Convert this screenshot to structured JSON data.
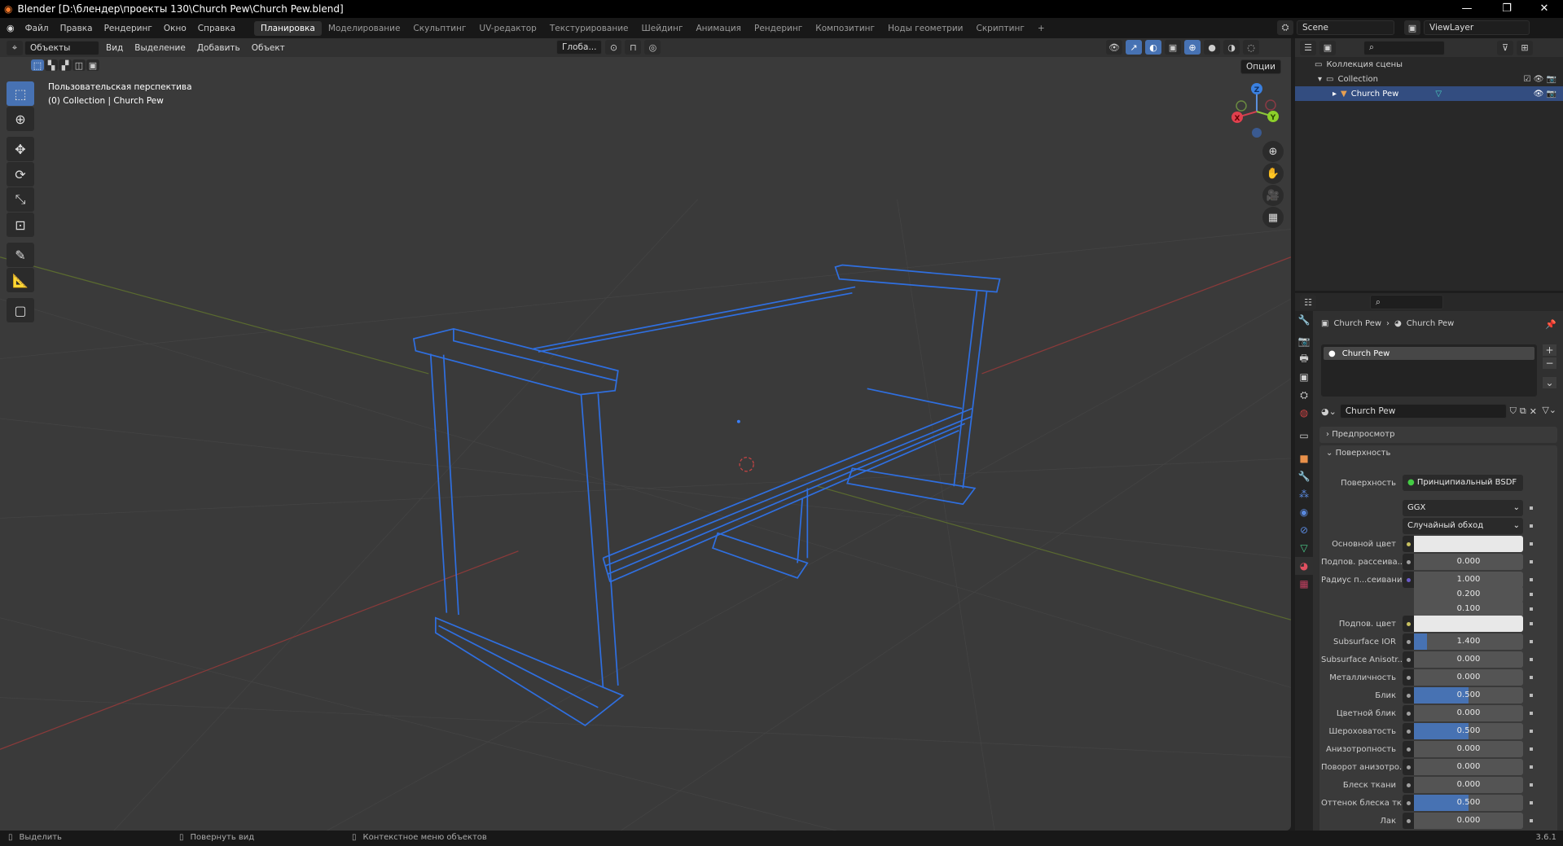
{
  "window": {
    "title": "Blender [D:\\блендер\\проекты 130\\Church Pew\\Church Pew.blend]",
    "minimize": "—",
    "maximize": "❐",
    "close": "✕"
  },
  "menu": {
    "items": [
      "Файл",
      "Правка",
      "Рендеринг",
      "Окно",
      "Справка"
    ]
  },
  "workspaces": {
    "tabs": [
      "Планировка",
      "Моделирование",
      "Скульптинг",
      "UV-редактор",
      "Текстурирование",
      "Шейдинг",
      "Анимация",
      "Рендеринг",
      "Композитинг",
      "Ноды геометрии",
      "Скриптинг",
      "+"
    ],
    "active": "Планировка"
  },
  "scene": {
    "scene_name": "Scene",
    "view_layer": "ViewLayer"
  },
  "viewport": {
    "mode": "Объекты",
    "menus": [
      "Вид",
      "Выделение",
      "Добавить",
      "Объект"
    ],
    "orientation": "Глоба...",
    "options": "Опции",
    "view_name": "Пользовательская перспектива",
    "view_info": "(0) Collection | Church Pew",
    "gizmo": {
      "z": "Z",
      "x": "X",
      "y": "Y"
    },
    "wire_color": "#2f6fe0"
  },
  "outliner": {
    "scene_collection": "Коллекция сцены",
    "collection": "Collection",
    "object": "Church Pew"
  },
  "properties": {
    "breadcrumb": [
      "Church Pew",
      "Church Pew"
    ],
    "slot": "Church Pew",
    "material_name": "Church Pew",
    "panels": {
      "preview": "Предпросмотр",
      "surface": "Поверхность"
    },
    "surface_label": "Поверхность",
    "surface_value": "Принципиальный BSDF",
    "distribution": "GGX",
    "subsurface_method": "Случайный обход",
    "rows": [
      {
        "label": "Основной цвет",
        "type": "color",
        "value": "#e8e8e8",
        "socket": "#c8c060"
      },
      {
        "label": "Подпов. рассеива...",
        "type": "num",
        "value": "0.000",
        "fill": 0
      },
      {
        "label": "Радиус п...сеивания",
        "type": "num",
        "value": "1.000",
        "fill": 0,
        "socket": "#6a5ac8"
      },
      {
        "label": "",
        "type": "num",
        "value": "0.200",
        "fill": 0,
        "nosock": true
      },
      {
        "label": "",
        "type": "num",
        "value": "0.100",
        "fill": 0,
        "nosock": true
      },
      {
        "label": "Подпов. цвет",
        "type": "color",
        "value": "#e8e8e8",
        "socket": "#c8c060"
      },
      {
        "label": "Subsurface IOR",
        "type": "num",
        "value": "1.400",
        "fill": 0.12
      },
      {
        "label": "Subsurface Anisotr...",
        "type": "num",
        "value": "0.000",
        "fill": 0
      },
      {
        "label": "Металличность",
        "type": "num",
        "value": "0.000",
        "fill": 0
      },
      {
        "label": "Блик",
        "type": "num",
        "value": "0.500",
        "fill": 0.5
      },
      {
        "label": "Цветной блик",
        "type": "num",
        "value": "0.000",
        "fill": 0
      },
      {
        "label": "Шероховатость",
        "type": "num",
        "value": "0.500",
        "fill": 0.5
      },
      {
        "label": "Анизотропность",
        "type": "num",
        "value": "0.000",
        "fill": 0
      },
      {
        "label": "Поворот анизотро...",
        "type": "num",
        "value": "0.000",
        "fill": 0
      },
      {
        "label": "Блеск ткани",
        "type": "num",
        "value": "0.000",
        "fill": 0
      },
      {
        "label": "Оттенок блеска тк...",
        "type": "num",
        "value": "0.500",
        "fill": 0.5
      },
      {
        "label": "Лак",
        "type": "num",
        "value": "0.000",
        "fill": 0
      }
    ]
  },
  "statusbar": {
    "select": "Выделить",
    "rotate": "Повернуть вид",
    "context": "Контекстное меню объектов",
    "version": "3.6.1"
  }
}
